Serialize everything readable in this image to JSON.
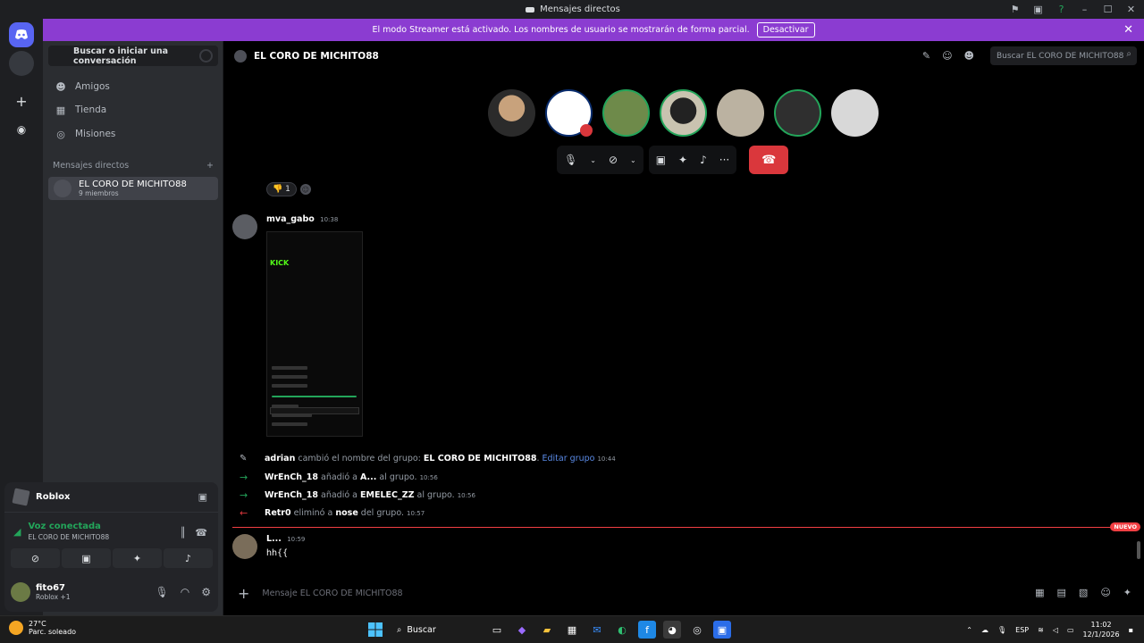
{
  "titlebar": {
    "title": "Mensajes directos"
  },
  "streamer": {
    "message": "El modo Streamer está activado. Los nombres de usuario se mostrarán de forma parcial.",
    "button": "Desactivar"
  },
  "sidebar": {
    "search": "Buscar o iniciar una conversación",
    "nav": [
      {
        "label": "Amigos",
        "icon": "people-icon"
      },
      {
        "label": "Tienda",
        "icon": "shop-icon"
      },
      {
        "label": "Misiones",
        "icon": "quest-icon"
      }
    ],
    "dm_header": "Mensajes directos",
    "dm_item": {
      "name": "EL CORO DE MICHITO88",
      "sub": "9 miembros"
    }
  },
  "panel": {
    "activity": "Roblox",
    "voice_label": "Voz conectada",
    "voice_channel": "EL CORO DE MICHITO88",
    "user_name": "fito67",
    "user_status": "Roblox +1"
  },
  "header": {
    "title": "EL CORO DE MICHITO88",
    "search_placeholder": "Buscar EL CORO DE MICHITO88"
  },
  "colors": {
    "accent": "#8b3cd1",
    "voice_green": "#23a55a",
    "hangup": "#da373c",
    "link": "#5a8ae6"
  },
  "chat": {
    "reaction_count": "1",
    "message1": {
      "author": "mva_gabo",
      "time": "10:38"
    },
    "phone": {
      "brand": "KICK"
    },
    "system": [
      {
        "user": "adrian",
        "text": "cambió el nombre del grupo:",
        "target": "EL CORO DE MICHITO88",
        "link": "Editar grupo",
        "time": "10:44"
      },
      {
        "user": "WrEnCh_18",
        "text": "añadió a",
        "target": "A...",
        "suffix": "al grupo.",
        "time": "10:56"
      },
      {
        "user": "WrEnCh_18",
        "text": "añadió a",
        "target": "EMELEC_ZZ",
        "suffix": "al grupo.",
        "time": "10:56"
      },
      {
        "user": "Retr0",
        "text": "eliminó a",
        "target": "nose",
        "suffix": "del grupo.",
        "time": "10:57"
      }
    ],
    "new_badge": "NUEVO",
    "message2": {
      "author": "L...",
      "time": "10:59",
      "text": "hh{{"
    }
  },
  "composer": {
    "placeholder": "Mensaje EL CORO DE MICHITO88"
  },
  "taskbar": {
    "temp": "27°C",
    "weather": "Parc. soleado",
    "search": "Buscar",
    "lang": "ESP",
    "time": "11:02",
    "date": "12/1/2026"
  }
}
